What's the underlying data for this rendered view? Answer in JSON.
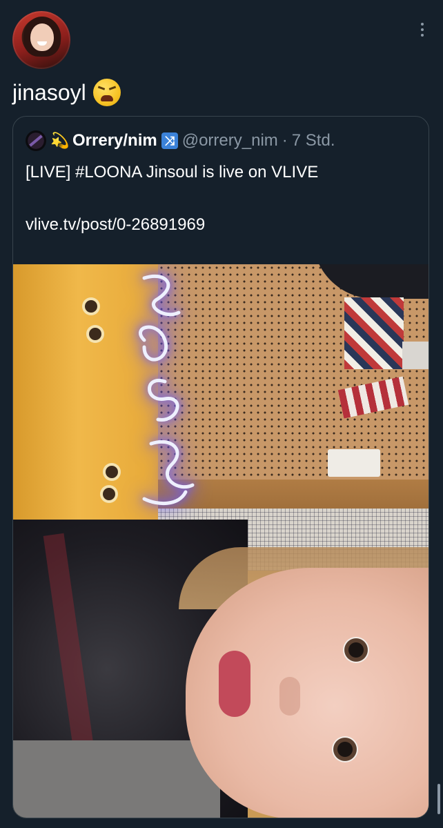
{
  "tweet": {
    "author_avatar": "author-avatar",
    "text": "jinasoyl",
    "emoji": "tired-face-emoji",
    "more_icon": "more-icon"
  },
  "quoted": {
    "avatar": "quoted-author-avatar",
    "badge_icon": "dizzy-icon",
    "display_name": "Orrery/nim",
    "verified_glyph": "⤨",
    "handle": "@orrery_nim",
    "separator": "·",
    "timestamp": "7 Std.",
    "line1": "[LIVE] #LOONA Jinsoul is live on VLIVE",
    "line2": "vlive.tv/post/0-26891969",
    "media": "selfie-photo",
    "neon_sign": "Jinsoul (neon, rotated)"
  },
  "colors": {
    "background": "#15202b",
    "text": "#ffffff",
    "secondary_text": "#8b98a5",
    "border": "#38444d",
    "verified": "#3b82d9"
  }
}
